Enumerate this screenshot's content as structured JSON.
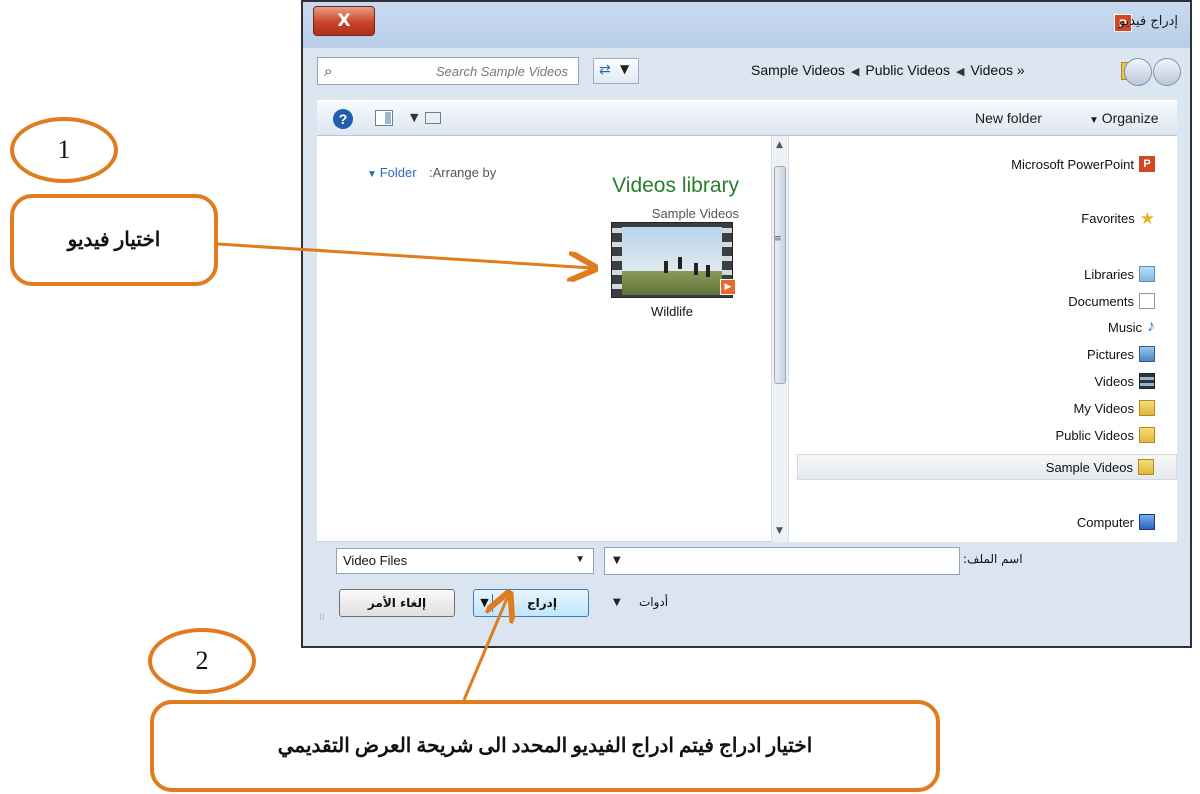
{
  "window": {
    "title": "إدراج فيديو",
    "close_label": "X",
    "app_icon": "P"
  },
  "address": {
    "search_placeholder": "Search Sample Videos",
    "breadcrumbs": [
      "Sample Videos",
      "Public Videos",
      "Videos"
    ],
    "overflow": "»"
  },
  "toolbar": {
    "new_folder_label": "New folder",
    "organize_label": "Organize"
  },
  "content": {
    "arrange_label": ":Arrange by",
    "folder_label": "Folder",
    "library_title": "Videos library",
    "library_subtitle": "Sample Videos",
    "items": [
      {
        "label": "Wildlife"
      }
    ]
  },
  "nav": {
    "items": [
      {
        "label": "Microsoft PowerPoint",
        "icon": "powerpoint-icon"
      },
      {
        "label": "Favorites",
        "icon": "star-icon"
      },
      {
        "label": "Libraries",
        "icon": "libraries-icon"
      },
      {
        "label": "Documents",
        "icon": "document-icon"
      },
      {
        "label": "Music",
        "icon": "music-icon"
      },
      {
        "label": "Pictures",
        "icon": "pictures-icon"
      },
      {
        "label": "Videos",
        "icon": "videos-icon"
      },
      {
        "label": "My Videos",
        "icon": "folder-icon"
      },
      {
        "label": "Public Videos",
        "icon": "folder-icon"
      },
      {
        "label": "Sample Videos",
        "icon": "folder-icon",
        "selected": true
      },
      {
        "label": "Computer",
        "icon": "computer-icon"
      }
    ]
  },
  "bottom": {
    "filter_value": "Video Files",
    "filename_label": "اسم الملف:",
    "filename_value": "",
    "tools_label": "أدوات",
    "insert_label": "إدراج",
    "cancel_label": "إلغاء الأمر"
  },
  "annotations": {
    "step1_number": "1",
    "step1_text": "اختيار فيديو",
    "step2_number": "2",
    "step2_text": "اختيار ادراج فيتم ادراج الفيديو المحدد الى شريحة العرض التقديمي"
  },
  "colors": {
    "annotation_border": "#e07c1e",
    "library_title": "#2a7d2a",
    "link_blue": "#2b6cb6"
  }
}
